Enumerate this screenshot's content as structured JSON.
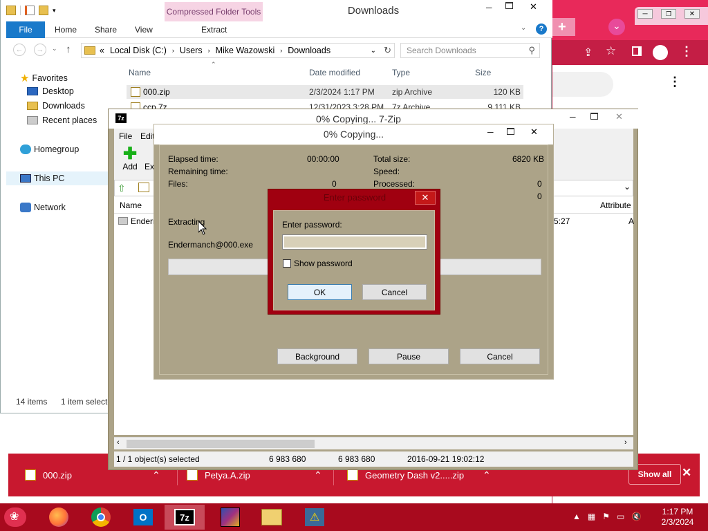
{
  "explorer": {
    "title": "Downloads",
    "contextual_tab": "Compressed Folder Tools",
    "ribbon_tabs": [
      "File",
      "Home",
      "Share",
      "View",
      "Extract"
    ],
    "address": {
      "crumb_prefix": "«",
      "segments": [
        "Local Disk (C:)",
        "Users",
        "Mike Wazowski",
        "Downloads"
      ]
    },
    "search_placeholder": "Search Downloads",
    "nav": {
      "favorites": "Favorites",
      "desktop": "Desktop",
      "downloads": "Downloads",
      "recent": "Recent places",
      "homegroup": "Homegroup",
      "thispc": "This PC",
      "network": "Network"
    },
    "columns": {
      "name": "Name",
      "date": "Date modified",
      "type": "Type",
      "size": "Size"
    },
    "files": [
      {
        "name": "000.zip",
        "date": "2/3/2024 1:17 PM",
        "type": "zip Archive",
        "size": "120 KB"
      },
      {
        "name": "ccp.7z",
        "date": "12/31/2023 3:28 PM",
        "type": "7z Archive",
        "size": "9,111 KB"
      }
    ],
    "status_items": "14 items",
    "status_selected": "1 item selecte"
  },
  "zip": {
    "title": "0% Copying... 7-Zip",
    "menu": [
      "File",
      "Edit"
    ],
    "toolbar": {
      "add": "Add",
      "extract": "Ext"
    },
    "list_name_col": "Name",
    "list_attr_col": "Attribute",
    "row_name": "Enderm",
    "row_time": "5:27",
    "row_attr": "A",
    "status": {
      "selected": "1 / 1 object(s) selected",
      "size": "6 983 680",
      "packed": "6 983 680",
      "date": "2016-09-21 19:02:12"
    }
  },
  "copy": {
    "title": "0% Copying...",
    "elapsed_label": "Elapsed time:",
    "elapsed_value": "00:00:00",
    "remaining_label": "Remaining time:",
    "files_label": "Files:",
    "files_value": "0",
    "total_label": "Total size:",
    "total_value": "6820 KB",
    "speed_label": "Speed:",
    "processed_label": "Processed:",
    "processed_value": "0",
    "extra_value": "0",
    "extracting": "Extracting",
    "filename": "Endermanch@000.exe",
    "progress": 0,
    "background_btn": "Background",
    "pause_btn": "Pause",
    "cancel_btn": "Cancel"
  },
  "password": {
    "title": "Enter password",
    "label": "Enter password:",
    "value": "",
    "show_label": "Show password",
    "ok": "OK",
    "cancel": "Cancel"
  },
  "downloads_bar": {
    "items": [
      "000.zip",
      "Petya.A.zip",
      "Geometry Dash v2.....zip"
    ],
    "show_all": "Show all"
  },
  "taskbar": {
    "time": "1:17 PM",
    "date": "2/3/2024",
    "apps": [
      "firefox-icon",
      "chrome-icon",
      "outlook-icon",
      "7zip-icon",
      "winrar-icon",
      "file-explorer-icon",
      "warning-icon"
    ]
  },
  "colors": {
    "accent": "#c8182f",
    "dialog_bg": "#aca388",
    "password_frame": "#a00010"
  }
}
